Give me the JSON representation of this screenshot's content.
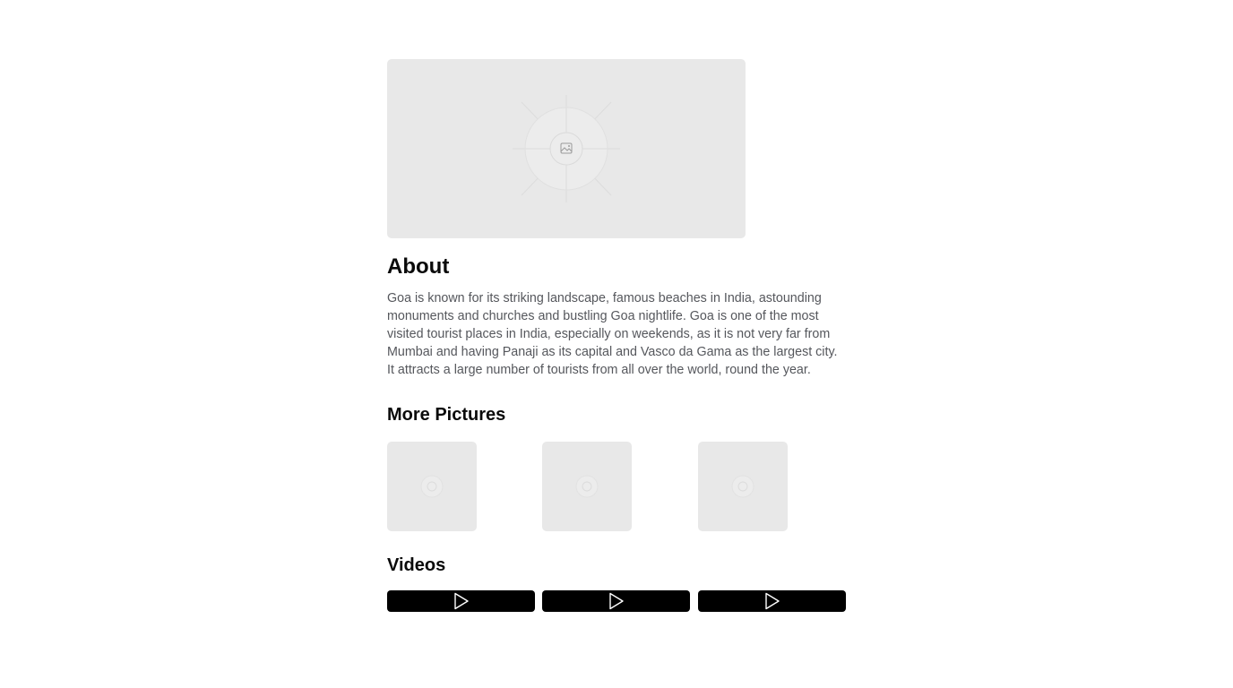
{
  "hero": {
    "icon": "image-placeholder-icon"
  },
  "about": {
    "title": "About",
    "text": "Goa is known for its striking landscape, famous beaches in India, astounding monuments and churches and bustling Goa nightlife. Goa is one of the most visited tourist places in India, especially on weekends, as it is not very far from Mumbai and having Panaji as its capital and Vasco da Gama as the largest city. It attracts a large number of tourists from all over the world, round the year."
  },
  "pictures": {
    "title": "More Pictures",
    "items": [
      {
        "icon": "image-placeholder-icon"
      },
      {
        "icon": "image-placeholder-icon"
      },
      {
        "icon": "image-placeholder-icon"
      }
    ]
  },
  "videos": {
    "title": "Videos",
    "items": [
      {
        "icon": "play-icon"
      },
      {
        "icon": "play-icon"
      },
      {
        "icon": "play-icon"
      }
    ]
  },
  "colors": {
    "placeholder_bg": "#e8e8e8",
    "heading": "#0a0a0a",
    "body_text": "#55575c",
    "video_bg": "#000000"
  }
}
